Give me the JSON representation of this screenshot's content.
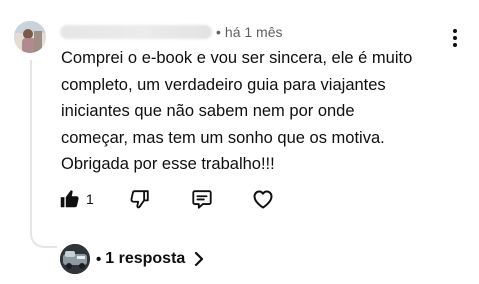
{
  "comment": {
    "time_ago": "há 1 mês",
    "separator": "•",
    "lines": [
      "Comprei o e-book e vou ser sincera, ele é muito",
      "completo, um verdadeiro guia para viajantes",
      "iniciantes que não sabem nem por onde",
      "começar, mas tem um sonho que os motiva.",
      "Obrigada por esse trabalho!!!"
    ]
  },
  "actions": {
    "like_count": "1",
    "like_icon": "thumbs-up-filled-icon",
    "dislike_icon": "thumbs-down-icon",
    "reply_icon": "comment-icon",
    "heart_icon": "heart-icon",
    "more_icon": "more-vertical-icon"
  },
  "replies": {
    "separator": "•",
    "label": "1 resposta",
    "chevron_icon": "chevron-right-icon"
  },
  "colors": {
    "text": "#0f0f0f",
    "secondary_text": "#606060",
    "thread_line": "#e5e5e5"
  }
}
